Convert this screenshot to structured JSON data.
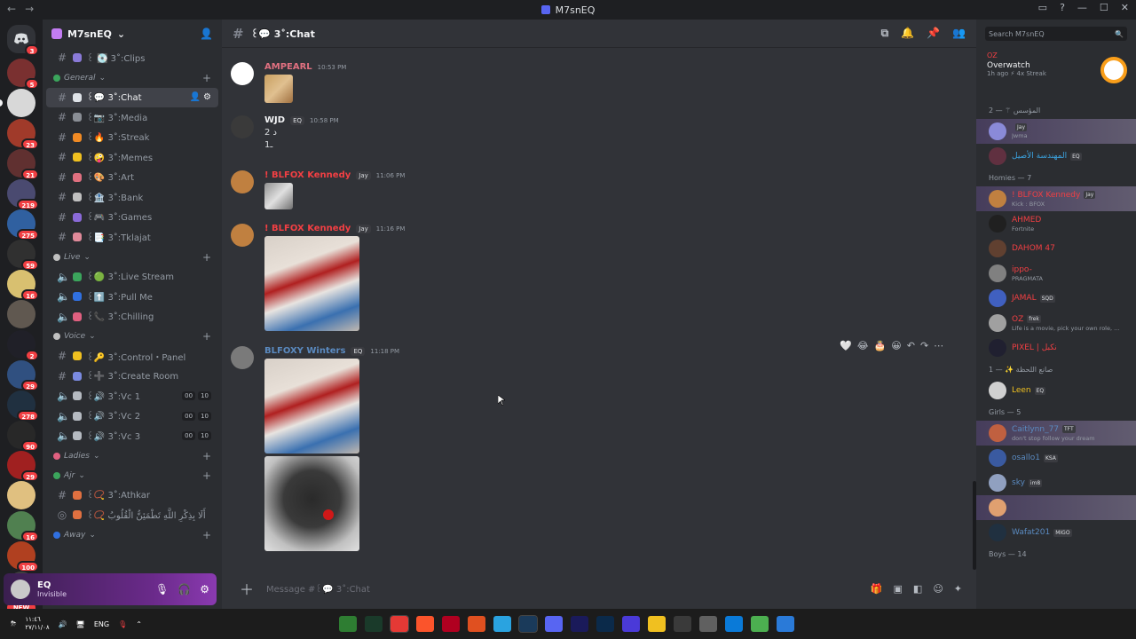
{
  "window": {
    "title": "M7snEQ",
    "nav_back": "←",
    "nav_forward": "→",
    "controls": [
      "▭",
      "?",
      "—",
      "☐",
      "✕"
    ]
  },
  "guilds": [
    {
      "badge": "3",
      "color": "#5865f2",
      "home": true
    },
    {
      "badge": "5",
      "color": "#7a3030"
    },
    {
      "badge": "",
      "color": "#d8d8d8"
    },
    {
      "badge": "23",
      "color": "#a03a2a"
    },
    {
      "badge": "21",
      "color": "#603030"
    },
    {
      "badge": "219",
      "color": "#4a4a70"
    },
    {
      "badge": "275",
      "color": "#3060a0"
    },
    {
      "badge": "59",
      "color": "#303030"
    },
    {
      "badge": "16",
      "color": "#d8c070"
    },
    {
      "badge": "",
      "color": "#605850"
    },
    {
      "badge": "2",
      "color": "#202028"
    },
    {
      "badge": "29",
      "color": "#305080"
    },
    {
      "badge": "278",
      "color": "#203040"
    },
    {
      "badge": "90",
      "color": "#282828"
    },
    {
      "badge": "29",
      "color": "#a02020"
    },
    {
      "badge": "",
      "color": "#e0c080"
    },
    {
      "badge": "16",
      "color": "#508050"
    },
    {
      "badge": "100",
      "color": "#b04020"
    },
    {
      "badge": "2",
      "color": "#404040"
    }
  ],
  "new_label": "NEW",
  "server": {
    "name": "M7snEQ"
  },
  "channels": [
    {
      "type": "cat",
      "label": "",
      "hidden": true
    },
    {
      "type": "text",
      "label": "꒰ 💽 3˚:Clips",
      "emoji": "#8a7ad8"
    },
    {
      "type": "cat",
      "label": "General",
      "dot": "#3ba55c"
    },
    {
      "type": "text",
      "label": "꒰💬 3˚:Chat",
      "emoji": "#dfe3e8",
      "active": true
    },
    {
      "type": "text",
      "label": "꒰📷 3˚:Media",
      "emoji": "#8a8e95"
    },
    {
      "type": "text",
      "label": "꒰🔥 3˚:Streak",
      "emoji": "#f08a24"
    },
    {
      "type": "text",
      "label": "꒰🤪 3˚:Memes",
      "emoji": "#f0c020"
    },
    {
      "type": "text",
      "label": "꒰🎨 3˚:Art",
      "emoji": "#e07080"
    },
    {
      "type": "text",
      "label": "꒰🏦 3˚:Bank",
      "emoji": "#c0c0c0"
    },
    {
      "type": "text",
      "label": "꒰🎮 3˚:Games",
      "emoji": "#8a6ad8"
    },
    {
      "type": "text",
      "label": "꒰📑 3˚:Tklajat",
      "emoji": "#e08a9a"
    },
    {
      "type": "cat",
      "label": "Live",
      "dot": "#c0c0c0"
    },
    {
      "type": "voice",
      "label": "꒰🟢 3˚:Live Stream",
      "emoji": "#3ba55c"
    },
    {
      "type": "voice",
      "label": "꒰⬆️ 3˚:Pull Me",
      "emoji": "#3070e0"
    },
    {
      "type": "voice",
      "label": "꒰📞 3˚:Chilling",
      "emoji": "#e06080"
    },
    {
      "type": "cat",
      "label": "Voice",
      "dot": "#c0c0c0"
    },
    {
      "type": "text",
      "label": "꒰🔑 3˚:Control・Panel",
      "emoji": "#f0c020"
    },
    {
      "type": "text",
      "label": "꒰➕ 3˚:Create Room",
      "emoji": "#7a8ae0"
    },
    {
      "type": "voice",
      "label": "꒰🔊 3˚:Vc 1",
      "emoji": "#b5bac1",
      "counts": [
        "00",
        "10"
      ]
    },
    {
      "type": "voice",
      "label": "꒰🔊 3˚:Vc 2",
      "emoji": "#b5bac1",
      "counts": [
        "00",
        "10"
      ]
    },
    {
      "type": "voice",
      "label": "꒰🔊 3˚:Vc 3",
      "emoji": "#b5bac1",
      "counts": [
        "00",
        "10"
      ]
    },
    {
      "type": "cat",
      "label": "Ladies",
      "dot": "#e06080"
    },
    {
      "type": "cat",
      "label": "Ajr",
      "dot": "#3ba55c"
    },
    {
      "type": "text",
      "label": "꒰📿 3˚:Athkar",
      "emoji": "#e07040"
    },
    {
      "type": "stage",
      "label": "꒰📿 أَلَا بِذِكْرِ اللَّهِ تَطْمَئِنُّ الْقُلُوبُ",
      "emoji": "#e07040"
    },
    {
      "type": "cat",
      "label": "Away",
      "dot": "#3070e0"
    }
  ],
  "user": {
    "name": "EQ",
    "status": "Invisible"
  },
  "chat": {
    "channel": "꒰💬 3˚:Chat",
    "composer_placeholder": "Message #꒰💬 3˚:Chat",
    "messages": [
      {
        "author": "AMPEARL",
        "color": "#e07080",
        "time": "10:53 PM",
        "tag": "",
        "lines": [],
        "avatar": "#ffffff"
      },
      {
        "author": "WJD",
        "color": "#f2f3f5",
        "time": "10:58 PM",
        "tag": "EQ",
        "lines": [
          "2 د",
          "1ـ"
        ],
        "avatar": "#3a3a3a"
      },
      {
        "author": "! BLFOX Kennedy",
        "color": "#f23f43",
        "time": "11:06 PM",
        "tag": "Jay",
        "lines": [],
        "avatar": "#c08040"
      },
      {
        "author": "! BLFOX Kennedy",
        "color": "#f23f43",
        "time": "11:16 PM",
        "tag": "Jay",
        "lines": [],
        "avatar": "#c08040"
      },
      {
        "author": "BLFOXY Winters",
        "color": "#5a8ac0",
        "time": "11:18 PM",
        "tag": "EQ",
        "lines": [],
        "avatar": "#7a7a7a"
      }
    ],
    "reactions": [
      "🤍",
      "😂",
      "🎂",
      "😀",
      "↶",
      "↷",
      "⋯"
    ]
  },
  "members": {
    "search_placeholder": "Search M7snEQ",
    "activity": {
      "user": "OZ",
      "game": "Overwatch",
      "time": "1h ago",
      "streak": "4x Streak"
    },
    "groups": [
      {
        "title": "المؤسس ⚚ — 2",
        "items": [
          {
            "name": "",
            "color": "#c77dff",
            "tag": "Jay",
            "sub": "Jwma",
            "highlight": true,
            "avatar": "#8a8ad8"
          },
          {
            "name": "المهندسة الأصيل",
            "color": "#3ba3e0",
            "tag": "EQ",
            "sub": "",
            "avatar": "#603040"
          }
        ]
      },
      {
        "title": "Homies — 7",
        "items": [
          {
            "name": "! BLFOX Kennedy",
            "color": "#f23f43",
            "tag": "Jay",
            "sub": "Kick : BFOX",
            "highlight": true,
            "avatar": "#c08040"
          },
          {
            "name": "AHMED",
            "color": "#f23f43",
            "tag": "",
            "sub": "Fortnite",
            "avatar": "#202020"
          },
          {
            "name": "DAHOM 47",
            "color": "#f23f43",
            "tag": "",
            "sub": "",
            "avatar": "#604030"
          },
          {
            "name": "ippo-",
            "color": "#f23f43",
            "tag": "",
            "sub": "PRAGMATA",
            "avatar": "#808080"
          },
          {
            "name": "JAMAL",
            "color": "#f23f43",
            "tag": "SQD",
            "sub": "",
            "avatar": "#4060c0"
          },
          {
            "name": "OZ",
            "color": "#f23f43",
            "tag": "frek",
            "sub": "Life is a movie, pick your own role, ...",
            "avatar": "#a0a0a0"
          },
          {
            "name": "PIXEL | نكبل",
            "color": "#f23f43",
            "tag": "",
            "sub": "",
            "avatar": "#202030"
          }
        ]
      },
      {
        "title": "صانع اللحظة ✨ — 1",
        "items": [
          {
            "name": "Leen",
            "color": "#f0c020",
            "tag": "EQ",
            "sub": "",
            "avatar": "#d0d0d0"
          }
        ]
      },
      {
        "title": "Girls — 5",
        "items": [
          {
            "name": "Caitlynn_77",
            "color": "#5a8ac0",
            "tag": "TFT",
            "sub": "don't stop follow your dream",
            "highlight": true,
            "avatar": "#c06040"
          },
          {
            "name": "osallo1",
            "color": "#5a8ac0",
            "tag": "KSA",
            "sub": "",
            "avatar": "#3a5aa0"
          },
          {
            "name": "sky",
            "color": "#5a8ac0",
            "tag": "im8",
            "sub": "",
            "avatar": "#90a0c0"
          },
          {
            "name": "",
            "color": "#5a8ac0",
            "tag": "",
            "sub": "",
            "highlight": true,
            "avatar": "#e0a070"
          },
          {
            "name": "Wafat201",
            "color": "#5a8ac0",
            "tag": "MIGO",
            "sub": "",
            "avatar": "#203040"
          }
        ]
      },
      {
        "title": "Boys — 14",
        "items": []
      }
    ]
  },
  "taskbar": {
    "lang": "ENG",
    "time": "١١:٤٦",
    "date": "٢٧/١١/٠٨",
    "apps": [
      "#2e7d32",
      "#1a3a2a",
      "#e53935",
      "#fb542b",
      "#b00020",
      "#e05020",
      "#2aa3e0",
      "#1a3a5a",
      "#5865f2",
      "#1a1a5a",
      "#0b2a4a",
      "#4a3ad8",
      "#f0c020",
      "#3a3a3a",
      "#606060",
      "#0a7ad8",
      "#4caf50",
      "#2a7ad8"
    ]
  }
}
